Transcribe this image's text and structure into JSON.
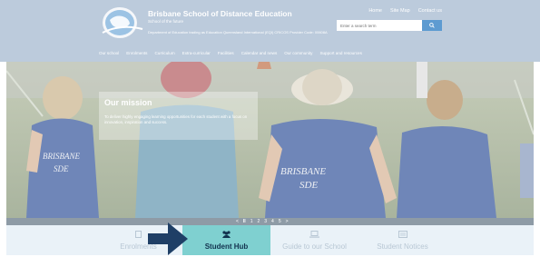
{
  "header": {
    "school_name": "Brisbane School of Distance Education",
    "school_sub": "School of the future",
    "school_dept": "Department of Education trading as Education Queensland International (EQI) CRICOS Provider Code: 00608A",
    "top_links": [
      "Home",
      "Site Map",
      "Contact us"
    ],
    "search_placeholder": "Enter a search term",
    "search_button_label": "Q",
    "nav": [
      "Our school",
      "Enrolments",
      "Curriculum",
      "Extra-curricular",
      "Facilities",
      "Calendar and news",
      "Our community",
      "Support and resources"
    ]
  },
  "hero": {
    "mission_title": "Our mission",
    "mission_text": "To deliver highly engaging learning opportunities for each student with a focus on innovation, inspiration and success.",
    "shirt_text_1": "BRISBANE",
    "shirt_text_2": "SDE",
    "shirt_text_3": "BRISBANE",
    "shirt_text_4": "SDE"
  },
  "pager": {
    "prev": "<",
    "pause": "II",
    "pages": [
      "1",
      "2",
      "3",
      "4",
      "5"
    ],
    "next": ">"
  },
  "tabs": [
    {
      "label": "Enrolments",
      "icon": "document-icon",
      "active": false
    },
    {
      "label": "Student Hub",
      "icon": "students-icon",
      "active": true
    },
    {
      "label": "Guide to our School",
      "icon": "laptop-icon",
      "active": false
    },
    {
      "label": "Student Notices",
      "icon": "notices-icon",
      "active": false
    }
  ],
  "colors": {
    "header_bg": "#bccbdc",
    "active_tab": "#7fd0d0",
    "arrow": "#1f3f66",
    "search_button": "#5d9bd1"
  }
}
